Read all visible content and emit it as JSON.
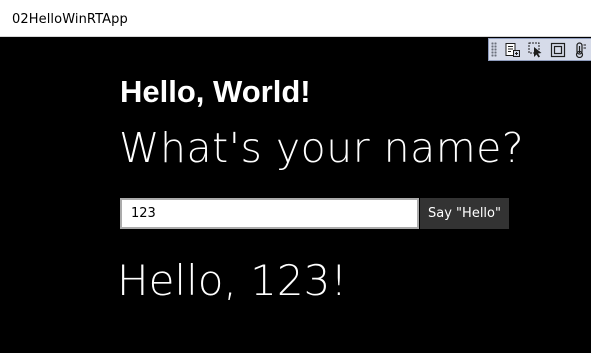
{
  "window": {
    "title": "02HelloWinRTApp"
  },
  "debug_toolbar": {
    "icons": [
      "go-to-live-visual-tree-icon",
      "select-element-icon",
      "display-layout-adorners-icon",
      "track-focus-icon"
    ]
  },
  "main": {
    "heading": "Hello, World!",
    "question": "What's your name?",
    "name_input": {
      "value": "123"
    },
    "say_hello_label": "Say \"Hello\"",
    "greeting": "Hello, 123!"
  },
  "colors": {
    "background": "#000000",
    "text": "#ffffff",
    "button_bg": "#333333",
    "input_border": "#ababab"
  }
}
